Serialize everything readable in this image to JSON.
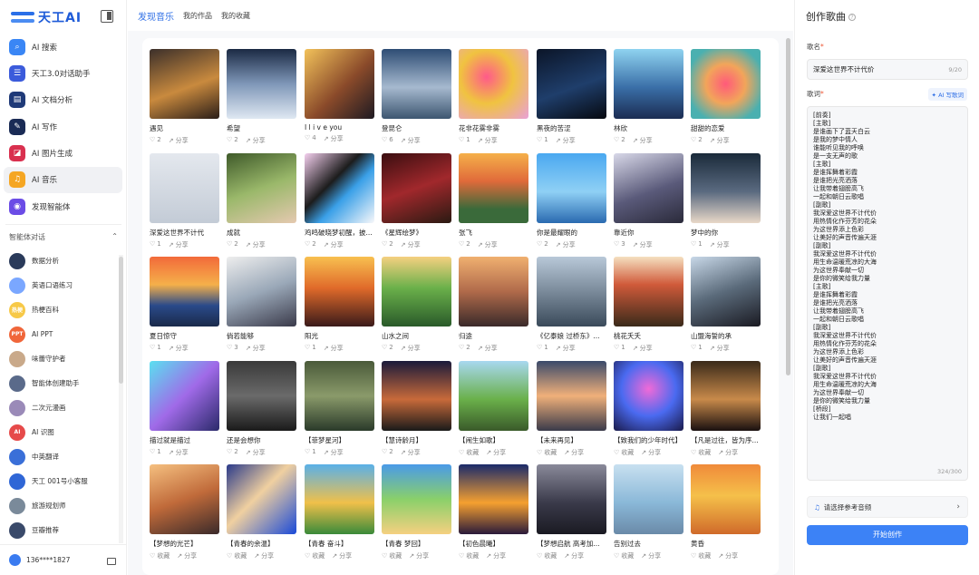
{
  "app": {
    "logo_text": "天工AI"
  },
  "nav": [
    {
      "label": "AI 搜索",
      "icon": "search-icon",
      "color": "#3a86f5",
      "glyph": "⌕",
      "active": false
    },
    {
      "label": "天工3.0对话助手",
      "icon": "chat-icon",
      "color": "#3b5bdb",
      "glyph": "☰",
      "active": false
    },
    {
      "label": "AI 文档分析",
      "icon": "document-icon",
      "color": "#1f3a78",
      "glyph": "▤",
      "active": false
    },
    {
      "label": "AI 写作",
      "icon": "write-icon",
      "color": "#1a2b55",
      "glyph": "✎",
      "active": false
    },
    {
      "label": "AI 图片生成",
      "icon": "image-icon",
      "color": "#d9304f",
      "glyph": "◪",
      "active": false
    },
    {
      "label": "AI 音乐",
      "icon": "music-icon",
      "color": "#f5a623",
      "glyph": "♫",
      "active": true
    },
    {
      "label": "发现智能体",
      "icon": "agent-icon",
      "color": "#6b4ce6",
      "glyph": "◉",
      "active": false
    }
  ],
  "agents_section": {
    "title": "智能体对话"
  },
  "agents": [
    {
      "label": "数据分析",
      "color": "#2a3a5a",
      "mark": ""
    },
    {
      "label": "英语口语练习",
      "color": "#7aa7ff",
      "mark": ""
    },
    {
      "label": "热梗百科",
      "color": "#f7c948",
      "mark": "热梗"
    },
    {
      "label": "AI PPT",
      "color": "#f0663a",
      "mark": "PPT"
    },
    {
      "label": "味蕾守护者",
      "color": "#c9a98a",
      "mark": ""
    },
    {
      "label": "智能体创建助手",
      "color": "#5a6a8a",
      "mark": ""
    },
    {
      "label": "二次元漫画",
      "color": "#9a8ab8",
      "mark": ""
    },
    {
      "label": "AI 识图",
      "color": "#e64a4a",
      "mark": "AI"
    },
    {
      "label": "中英翻译",
      "color": "#3a6fd8",
      "mark": ""
    },
    {
      "label": "天工 001号小客服",
      "color": "#2f66d6",
      "mark": ""
    },
    {
      "label": "旅游规划师",
      "color": "#7a8a9a",
      "mark": ""
    },
    {
      "label": "豆瓣推荐",
      "color": "#3a4a6a",
      "mark": ""
    }
  ],
  "user": {
    "phone": "136****1827"
  },
  "tabs": [
    {
      "label": "发现音乐",
      "active": true
    },
    {
      "label": "我的作品",
      "active": false
    },
    {
      "label": "我的收藏",
      "active": false
    }
  ],
  "songs": [
    {
      "title": "遇见",
      "likes": "2",
      "share": "分享",
      "bg": "linear-gradient(160deg,#3b2f2a,#c98a3e 55%,#2a1d18)"
    },
    {
      "title": "希望",
      "likes": "2",
      "share": "分享",
      "bg": "linear-gradient(180deg,#1b2a44,#7f97b8 50%,#dfe8f2)"
    },
    {
      "title": "I l i v e you",
      "likes": "4",
      "share": "分享",
      "bg": "linear-gradient(135deg,#f2c25a,#8a4a2a 55%,#1e1a22)"
    },
    {
      "title": "登昆仑",
      "likes": "6",
      "share": "分享",
      "bg": "linear-gradient(180deg,#2e4d74,#a6b9cf 55%,#3d5670)"
    },
    {
      "title": "花非花雾非雾",
      "likes": "1",
      "share": "分享",
      "bg": "radial-gradient(circle at 40% 40%,#ff5a8a,#f0c340 45%,#e9a0d8)"
    },
    {
      "title": "黑夜的苦涩",
      "likes": "1",
      "share": "分享",
      "bg": "linear-gradient(160deg,#0b1528,#1f3e6b 55%,#06090f)"
    },
    {
      "title": "林欣",
      "likes": "2",
      "share": "分享",
      "bg": "linear-gradient(180deg,#8fd3f0,#3a6fa8 55%,#1b2c52)"
    },
    {
      "title": "甜甜的恋爱",
      "likes": "2",
      "share": "分享",
      "bg": "radial-gradient(circle at 50% 50%,#ff5a7a,#f2a55a 40%,#4ab0b0 80%)"
    },
    {
      "title": "深爱这世界不计代",
      "likes": "1",
      "share": "分享",
      "bg": "linear-gradient(180deg,#e4e8ee,#c3cbd6)"
    },
    {
      "title": "成就",
      "likes": "2",
      "share": "分享",
      "bg": "linear-gradient(160deg,#3f5a2a,#9ab86a 50%,#e5c9b0)"
    },
    {
      "title": "鸡鸣破晓梦初醒，披...",
      "likes": "2",
      "share": "分享",
      "bg": "linear-gradient(135deg,#f5d0ef,#1c1c1c 40%,#3aa0e8 60%,#f8f8fa)"
    },
    {
      "title": "《星辉绘梦》",
      "likes": "2",
      "share": "分享",
      "bg": "linear-gradient(160deg,#3a0e10,#a1282c 50%,#2a1a12)"
    },
    {
      "title": "张飞",
      "likes": "2",
      "share": "分享",
      "bg": "linear-gradient(180deg,#f5b04a,#e06a3a 40%,#3a6a3a 80%)"
    },
    {
      "title": "你是最耀眼的",
      "likes": "2",
      "share": "分享",
      "bg": "linear-gradient(180deg,#4aa8f0,#8fd0f5 55%,#2a6ab0)"
    },
    {
      "title": "靠近你",
      "likes": "3",
      "share": "分享",
      "bg": "linear-gradient(160deg,#d8d8e8,#5a5a7a 55%,#2a2a3a)"
    },
    {
      "title": "梦中的你",
      "likes": "1",
      "share": "分享",
      "bg": "linear-gradient(180deg,#1a2a3a,#5a6a80 55%,#e8d8c8)"
    },
    {
      "title": "夏日惊守",
      "likes": "1",
      "share": "分享",
      "bg": "linear-gradient(180deg,#f26a3a,#f5b04a 40%,#2a4a8a 70%,#1a2a4a)"
    },
    {
      "title": "倘若能够",
      "likes": "3",
      "share": "分享",
      "bg": "linear-gradient(160deg,#eeeeee,#9aa8b8 50%,#3a3a4a)"
    },
    {
      "title": "阳光",
      "likes": "1",
      "share": "分享",
      "bg": "linear-gradient(180deg,#f8c050,#e06a2a 45%,#3a1a1a)"
    },
    {
      "title": "山水之间",
      "likes": "2",
      "share": "分享",
      "bg": "linear-gradient(180deg,#f5d080,#6ab04a 45%,#2a5a2a)"
    },
    {
      "title": "归途",
      "likes": "2",
      "share": "分享",
      "bg": "linear-gradient(180deg,#f0b070,#b06a4a 50%,#3a2a2a)"
    },
    {
      "title": "《亿泰娘 过桥东》...",
      "likes": "1",
      "share": "分享",
      "bg": "linear-gradient(180deg,#b8c8d8,#7a8a9a 50%,#3a4a5a)"
    },
    {
      "title": "桃花夭夭",
      "likes": "1",
      "share": "分享",
      "bg": "linear-gradient(180deg,#f5e0c0,#d05a3a 40%,#3a2a1a)"
    },
    {
      "title": "山盟海誓的承",
      "likes": "1",
      "share": "分享",
      "bg": "linear-gradient(160deg,#c8d8e8,#5a6a7a 50%,#1a1a22)"
    },
    {
      "title": "描过就是描过",
      "likes": "1",
      "share": "分享",
      "bg": "linear-gradient(135deg,#5ae0f0,#a06ae8 50%,#2a2a6a)"
    },
    {
      "title": "还是会想你",
      "likes": "2",
      "share": "分享",
      "bg": "linear-gradient(180deg,#3a3a3a,#6a6a6a 50%,#1a1a1a)"
    },
    {
      "title": "【菲梦星河】",
      "likes": "1",
      "share": "分享",
      "bg": "linear-gradient(180deg,#4a5a3a,#8a9a6a 50%,#2a3a2a)"
    },
    {
      "title": "【慧诗龄月】",
      "likes": "2",
      "share": "分享",
      "bg": "linear-gradient(180deg,#1a1a3a,#c86a3a 55%,#1a1a1a)"
    },
    {
      "title": "【闹生如歌】",
      "likes": "收藏",
      "share": "分享",
      "bg": "linear-gradient(180deg,#a8d8f0,#6ab04a 55%,#3a5a2a)"
    },
    {
      "title": "【未来再见】",
      "likes": "收藏",
      "share": "分享",
      "bg": "linear-gradient(180deg,#3a4a6a,#f0b07a 50%,#3a3a4a)"
    },
    {
      "title": "【致我们的少年时代】",
      "likes": "收藏",
      "share": "分享",
      "bg": "radial-gradient(circle at 50% 40%,#f06ad8,#4a6af0 50%,#1a1a4a)"
    },
    {
      "title": "【凡是过往，皆为序...",
      "likes": "收藏",
      "share": "分享",
      "bg": "linear-gradient(180deg,#3a2a1a,#c88a4a 55%,#1a1010)"
    },
    {
      "title": "【梦想的光芒】",
      "likes": "收藏",
      "share": "分享",
      "bg": "linear-gradient(160deg,#f5c080,#c06a3a 50%,#3a2a2a)"
    },
    {
      "title": "【青春的余温】",
      "likes": "收藏",
      "share": "分享",
      "bg": "linear-gradient(135deg,#2a3a8a,#f0d0a0 45%,#1a4ad8)"
    },
    {
      "title": "【青春 奋斗】",
      "likes": "收藏",
      "share": "分享",
      "bg": "linear-gradient(180deg,#5ab0e8,#f0c04a 55%,#3a8a3a)"
    },
    {
      "title": "【青春 梦回】",
      "likes": "收藏",
      "share": "分享",
      "bg": "linear-gradient(180deg,#4a9ae8,#8ad06a 50%,#f5d080)"
    },
    {
      "title": "【初色晨曦】",
      "likes": "收藏",
      "share": "分享",
      "bg": "linear-gradient(180deg,#1a2a6a,#f5a030 55%,#2a1a3a)"
    },
    {
      "title": "【梦想启航 高考加...",
      "likes": "收藏",
      "share": "分享",
      "bg": "linear-gradient(180deg,#8a8a9a,#3a3a4a 55%,#1a1a22)"
    },
    {
      "title": "告别过去",
      "likes": "收藏",
      "share": "分享",
      "bg": "linear-gradient(180deg,#c8e0f0,#8ab8d8 55%,#6a8aa8)"
    },
    {
      "title": "黄昏",
      "likes": "收藏",
      "share": "分享",
      "bg": "linear-gradient(180deg,#f08a3a,#f5c04a 45%,#d06a2a)"
    }
  ],
  "panel": {
    "title": "创作歌曲",
    "name_label": "歌名",
    "name_value": "深爱这世界不计代价",
    "name_counter": "9/20",
    "lyrics_label": "歌词",
    "ai_write_label": "AI 写歌词",
    "lyrics": [
      "[前奏]",
      "[主歌]",
      "是谁画下了蓝天白云",
      "是我的梦中情人",
      "谁能听见我的呼唤",
      "是一支无声的歌",
      "[主歌]",
      "是谁挥舞着彩霞",
      "是谁把光亮洒落",
      "让我带着翅膀高飞",
      "一起和朝日云歌唱",
      "[副歌]",
      "我深爱这世界不计代价",
      "用热情化作芬芳的花朵",
      "为这世界添上色彩",
      "让美好的声音传遍天涯",
      "[副歌]",
      "我深爱这世界不计代价",
      "用生命温暖荒凉的大海",
      "为这世界奉献一切",
      "是你的微笑给我力量",
      "[主歌]",
      "是谁挥舞着彩霞",
      "是谁把光亮洒落",
      "让我带着翅膀高飞",
      "一起和朝日云歌唱",
      "[副歌]",
      "我深爱这世界不计代价",
      "用热情化作芬芳的花朵",
      "为这世界添上色彩",
      "让美好的声音传遍天涯",
      "[副歌]",
      "我深爱这世界不计代价",
      "用生命温暖荒凉的大海",
      "为这世界奉献一切",
      "是你的微笑给我力量",
      "[桥段]",
      "让我们一起唱"
    ],
    "lyrics_counter": "324/300",
    "ref_label": "请选择参考音频",
    "create_label": "开始创作"
  }
}
